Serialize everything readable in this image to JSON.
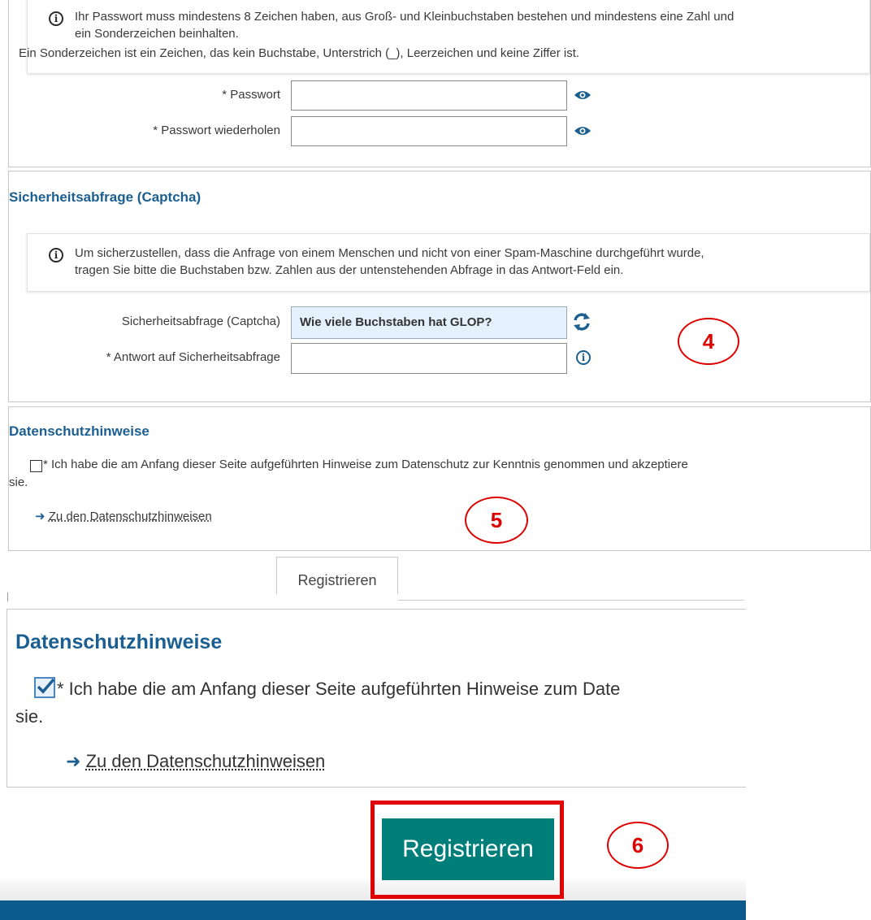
{
  "password_section": {
    "info_line1": "Ihr Passwort muss mindestens 8 Zeichen haben, aus Groß- und Kleinbuchstaben bestehen und mindestens eine Zahl und",
    "info_line2": "ein Sonderzeichen beinhalten.",
    "info_line3": "Ein Sonderzeichen ist ein Zeichen, das kein Buchstabe, Unterstrich (_), Leerzeichen und keine Ziffer ist.",
    "password_label": "* Passwort",
    "password_value": "",
    "password_repeat_label": "* Passwort wiederholen",
    "password_repeat_value": ""
  },
  "captcha_section": {
    "title": "Sicherheitsabfrage (Captcha)",
    "info_line1": "Um sicherzustellen, dass die Anfrage von einem Menschen und nicht von einer Spam-Maschine durchgeführt wurde,",
    "info_line2": "tragen Sie bitte die Buchstaben bzw. Zahlen aus der untenstehenden Abfrage in das Antwort-Feld ein.",
    "question_label": "Sicherheitsabfrage (Captcha)",
    "question": "Wie viele Buchstaben hat GLOP?",
    "answer_label": "* Antwort auf Sicherheitsabfrage",
    "answer_value": ""
  },
  "privacy_section": {
    "title": "Datenschutzhinweise",
    "consent_line1": "* Ich habe die am Anfang dieser Seite aufgeführten Hinweise zum Datenschutz zur Kenntnis genommen und akzeptiere",
    "consent_line2": "sie.",
    "link": "Zu den Datenschutzhinweisen",
    "checked": false
  },
  "register_button_small": "Registrieren",
  "zoomed_privacy": {
    "title": "Datenschutzhinweise",
    "consent_line1": "* Ich habe die am Anfang dieser Seite aufgeführten Hinweise zum Date",
    "consent_line2": "sie.",
    "link": "Zu den Datenschutzhinweisen",
    "checked": true
  },
  "register_button_large": "Registrieren",
  "annotations": {
    "step4": "4",
    "step5": "5",
    "step6": "6"
  },
  "colors": {
    "accent_blue": "#1b5f92",
    "button_teal": "#007f7a",
    "annotation_red": "#e00000",
    "footer_blue": "#0d5a8c"
  }
}
